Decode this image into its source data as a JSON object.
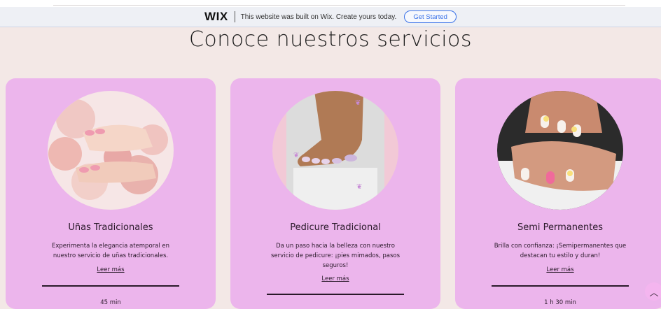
{
  "wix_banner": {
    "logo": "WIX",
    "message": "This website was built on Wix. Create yours today.",
    "button_label": "Get Started"
  },
  "section": {
    "title": "Conoce nuestros servicios"
  },
  "services": [
    {
      "title": "Uñas Tradicionales",
      "description": "Experimenta la elegancia atemporal en nuestro servicio de uñas tradicionales.",
      "read_more": "Leer más",
      "duration": "45 min"
    },
    {
      "title": "Pedicure Tradicional",
      "description": "Da un paso hacia la belleza con nuestro servicio de pedicure: ¡pies mimados, pasos seguros!",
      "read_more": "Leer más",
      "duration": ""
    },
    {
      "title": "Semi Permanentes",
      "description": "Brilla con confianza: ¡Semipermanentes que destacan tu estilo y duran!",
      "read_more": "Leer más",
      "duration": "1 h 30 min"
    }
  ],
  "colors": {
    "card_bg": "#ecb5ec",
    "page_bg": "#f3e8e6",
    "wix_accent": "#3a72e8"
  },
  "icons": {
    "scroll_top": "chevron-up-icon"
  }
}
